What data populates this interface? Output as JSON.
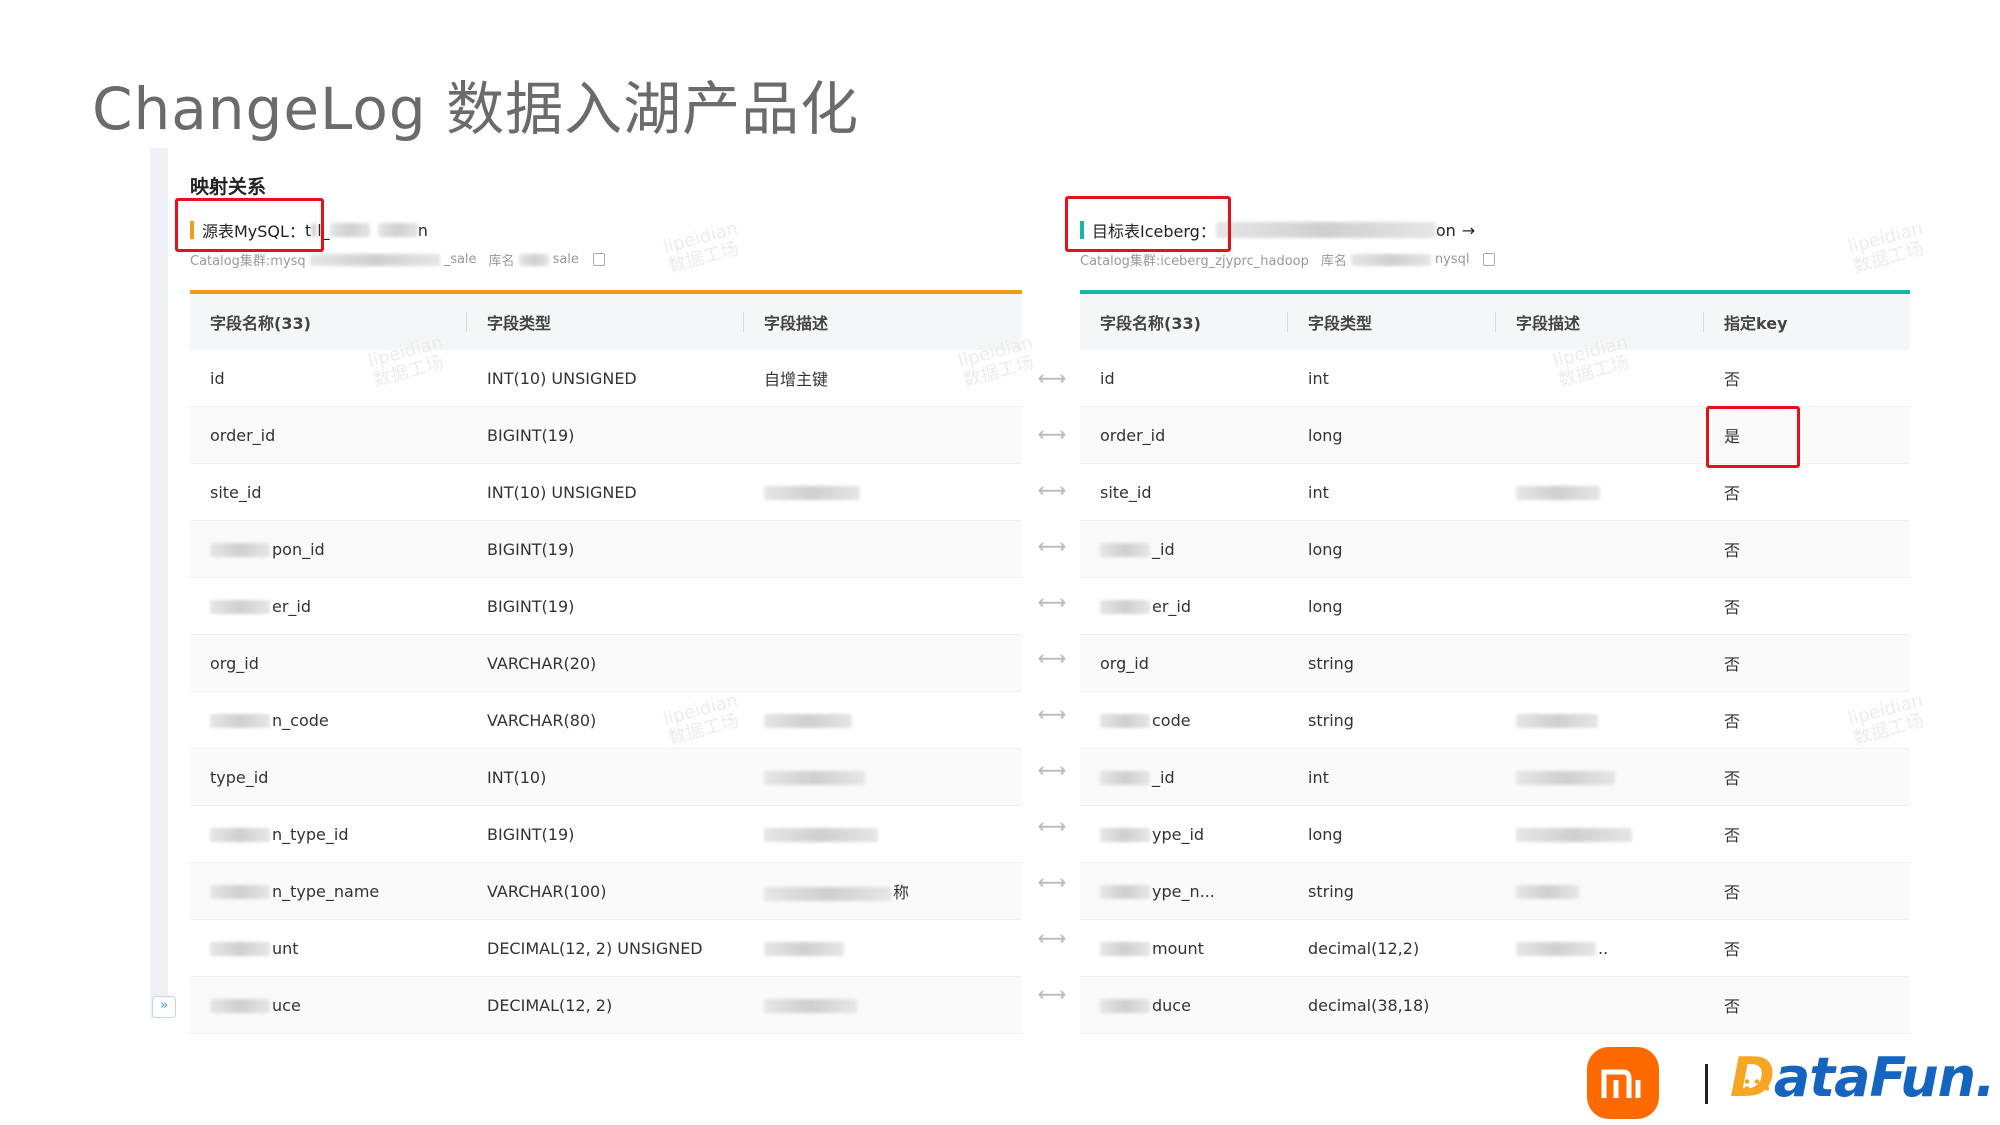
{
  "slide": {
    "title": "ChangeLog 数据入湖产品化"
  },
  "section": {
    "title": "映射关系"
  },
  "source": {
    "label_prefix": "源表MySQL：",
    "name_visible_start": "t",
    "name_visible_mid": "l_",
    "name_visible_end": "n",
    "meta_prefix": "Catalog集群:mysq",
    "meta_mid": "_sale",
    "meta_db_label": "库名",
    "meta_db_tail": "sale",
    "accent_color": "#f39a16",
    "columns": [
      "字段名称(33)",
      "字段类型",
      "字段描述"
    ],
    "rows": [
      {
        "name": "id",
        "type": "INT(10) UNSIGNED",
        "desc": "自增主键"
      },
      {
        "name": "order_id",
        "type": "BIGINT(19)",
        "desc": ""
      },
      {
        "name": "site_id",
        "type": "INT(10) UNSIGNED",
        "desc": ""
      },
      {
        "name": "pon_id",
        "type": "BIGINT(19)",
        "desc": ""
      },
      {
        "name": "er_id",
        "type": "BIGINT(19)",
        "desc": ""
      },
      {
        "name": "org_id",
        "type": "VARCHAR(20)",
        "desc": ""
      },
      {
        "name": "n_code",
        "type": "VARCHAR(80)",
        "desc": ""
      },
      {
        "name": "type_id",
        "type": "INT(10)",
        "desc": ""
      },
      {
        "name": "n_type_id",
        "type": "BIGINT(19)",
        "desc": ""
      },
      {
        "name": "n_type_name",
        "type": "VARCHAR(100)",
        "desc": "称"
      },
      {
        "name": "unt",
        "type": "DECIMAL(12, 2) UNSIGNED",
        "desc": ""
      },
      {
        "name": "uce",
        "type": "DECIMAL(12, 2)",
        "desc": ""
      }
    ]
  },
  "target": {
    "label_prefix": "目标表Iceberg：",
    "name_visible_end": "on",
    "arrow": "→",
    "meta_prefix": "Catalog集群:iceberg_zjyprc_hadoop",
    "meta_db_label": "库名",
    "meta_db_tail": "nysql",
    "accent_color": "#15b6a8",
    "columns": [
      "字段名称(33)",
      "字段类型",
      "字段描述",
      "指定key"
    ],
    "rows": [
      {
        "name": "id",
        "type": "int",
        "desc": "",
        "key": "否"
      },
      {
        "name": "order_id",
        "type": "long",
        "desc": "",
        "key": "是"
      },
      {
        "name": "site_id",
        "type": "int",
        "desc": "",
        "key": "否"
      },
      {
        "name": "_id",
        "type": "long",
        "desc": "",
        "key": "否"
      },
      {
        "name": "er_id",
        "type": "long",
        "desc": "",
        "key": "否"
      },
      {
        "name": "org_id",
        "type": "string",
        "desc": "",
        "key": "否"
      },
      {
        "name": "code",
        "type": "string",
        "desc": "",
        "key": "否"
      },
      {
        "name": "_id",
        "type": "int",
        "desc": "",
        "key": "否"
      },
      {
        "name": "ype_id",
        "type": "long",
        "desc": "",
        "key": "否"
      },
      {
        "name": "ype_n...",
        "type": "string",
        "desc": "",
        "key": "否"
      },
      {
        "name": "mount",
        "type": "decimal(12,2)",
        "desc": "..",
        "key": "否"
      },
      {
        "name": "duce",
        "type": "decimal(38,18)",
        "desc": "",
        "key": "否"
      }
    ]
  },
  "mapping_arrow": "⟷",
  "watermark": {
    "line1": "lipeidian",
    "line2": "数据工场"
  },
  "rail_toggle": "»",
  "logos": {
    "mi": "mi",
    "datafun_d": "D",
    "datafun_rest": "ataFun."
  }
}
